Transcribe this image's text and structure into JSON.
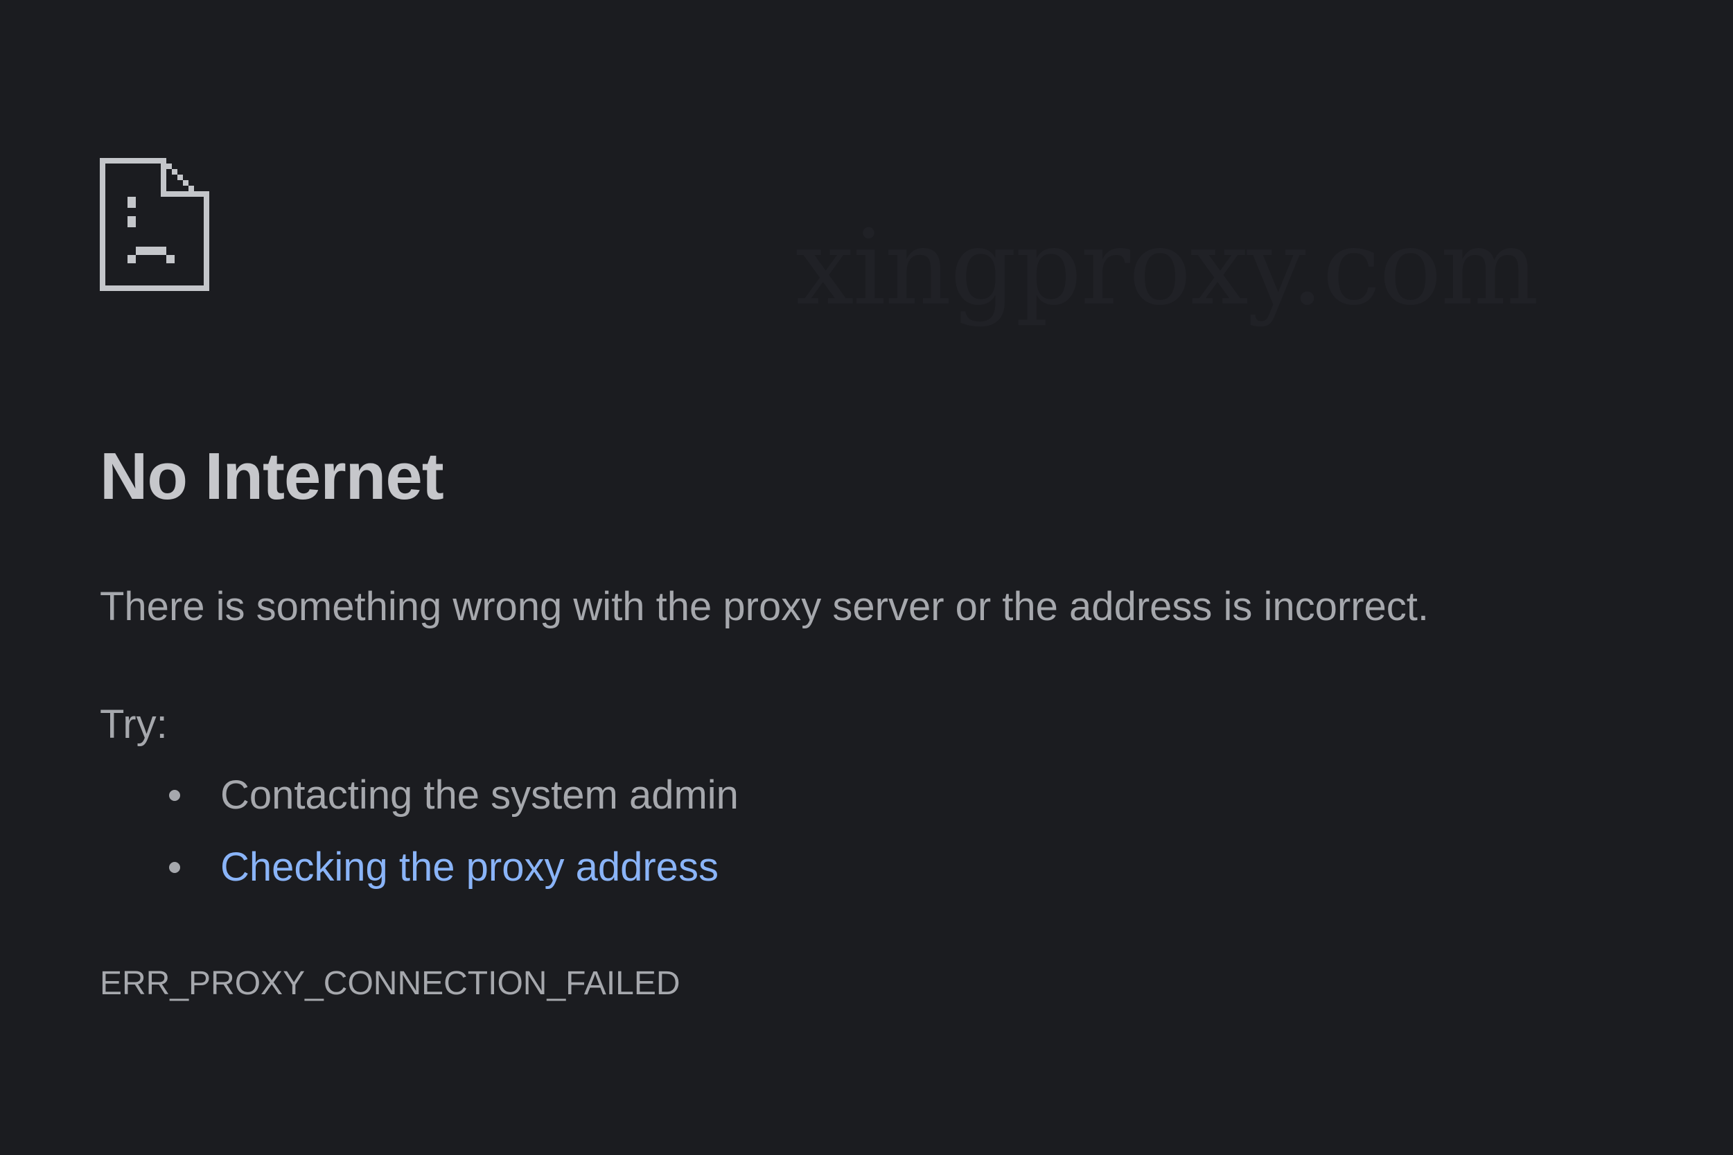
{
  "watermark": "xingproxy.com",
  "icon": "sad-page-icon",
  "error": {
    "title": "No Internet",
    "message": "There is something wrong with the proxy server or the address is incorrect.",
    "try_label": "Try:",
    "suggestions": [
      {
        "label": "Contacting the system admin",
        "is_link": false
      },
      {
        "label": "Checking the proxy address",
        "is_link": true
      }
    ],
    "code": "ERR_PROXY_CONNECTION_FAILED"
  },
  "colors": {
    "background": "#1b1c20",
    "text": "#a6a8ad",
    "title": "#c6c7cb",
    "link": "#8ab4f8",
    "icon": "#c4c6ca"
  }
}
